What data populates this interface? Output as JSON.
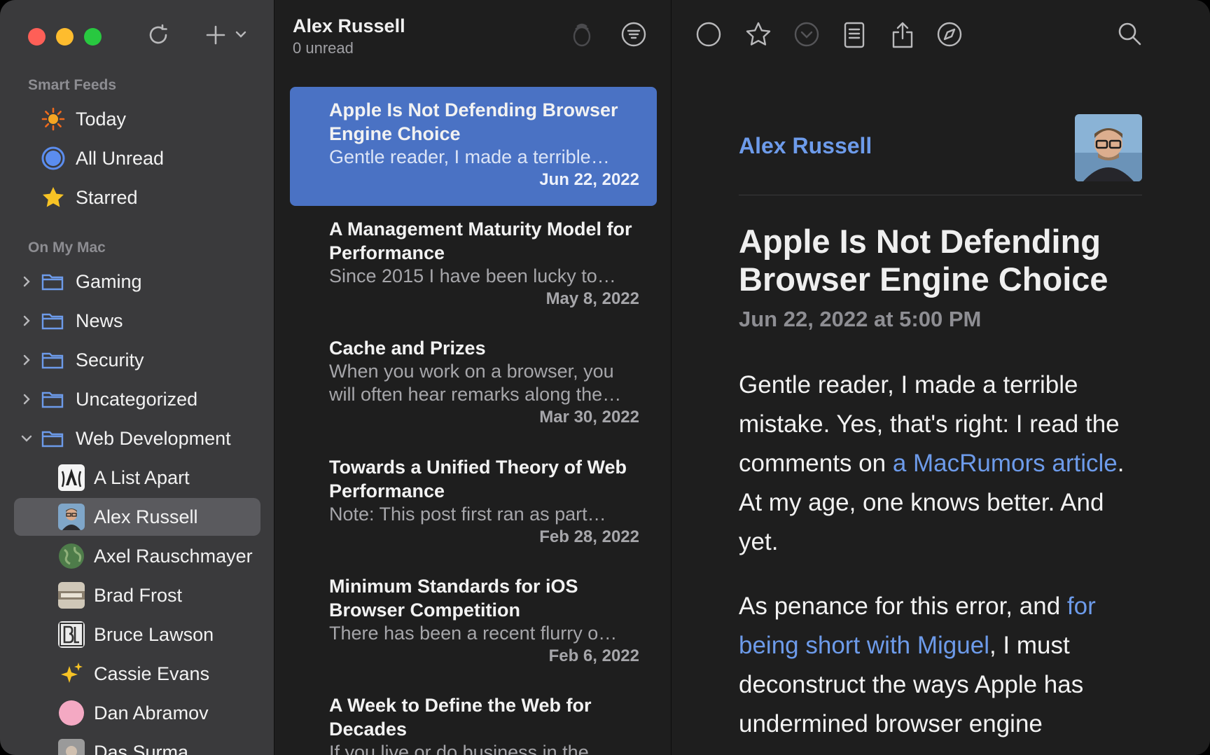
{
  "sidebar": {
    "smart_feeds_header": "Smart Feeds",
    "smart_feeds": [
      {
        "label": "Today",
        "icon": "sun-icon"
      },
      {
        "label": "All Unread",
        "icon": "unread-circle-icon"
      },
      {
        "label": "Starred",
        "icon": "star-icon"
      }
    ],
    "on_my_mac_header": "On My Mac",
    "folders": [
      {
        "label": "Gaming",
        "expanded": false
      },
      {
        "label": "News",
        "expanded": false
      },
      {
        "label": "Security",
        "expanded": false
      },
      {
        "label": "Uncategorized",
        "expanded": false
      },
      {
        "label": "Web Development",
        "expanded": true
      }
    ],
    "feeds": [
      {
        "label": "A List Apart",
        "icon": "a-list-apart-icon"
      },
      {
        "label": "Alex Russell",
        "icon": "alex-russell-avatar",
        "selected": true
      },
      {
        "label": "Axel Rauschmayer",
        "icon": "globe-icon"
      },
      {
        "label": "Brad Frost",
        "icon": "brad-frost-icon"
      },
      {
        "label": "Bruce Lawson",
        "icon": "bruce-lawson-icon"
      },
      {
        "label": "Cassie Evans",
        "icon": "sparkles-icon"
      },
      {
        "label": "Dan Abramov",
        "icon": "pink-circle-icon"
      },
      {
        "label": "Das Surma",
        "icon": "das-surma-avatar"
      }
    ]
  },
  "list": {
    "title": "Alex Russell",
    "subtitle": "0 unread",
    "articles": [
      {
        "title": "Apple Is Not Defending Browser Engine Choice",
        "summary": "Gentle reader, I made a terrible…",
        "date": "Jun 22, 2022",
        "selected": true
      },
      {
        "title": "A Management Maturity Model for Performance",
        "summary": "Since 2015 I have been lucky to…",
        "date": "May 8, 2022"
      },
      {
        "title": "Cache and Prizes",
        "summary": "When you work on a browser, you will often hear remarks along the…",
        "date": "Mar 30, 2022"
      },
      {
        "title": "Towards a Unified Theory of Web Performance",
        "summary": "Note: This post first ran as part…",
        "date": "Feb 28, 2022"
      },
      {
        "title": "Minimum Standards for iOS Browser Competition",
        "summary": "There has been a recent flurry o…",
        "date": "Feb 6, 2022"
      },
      {
        "title": "A Week to Define the Web for Decades",
        "summary": "If you live or do business in the…",
        "date": ""
      }
    ]
  },
  "reader": {
    "author": "Alex Russell",
    "title": "Apple Is Not Defending Browser Engine Choice",
    "date": "Jun 22, 2022 at 5:00 PM",
    "p1_a": "Gentle reader, I made a terrible mistake. Yes, that's right: I read the comments on ",
    "p1_link": "a MacRumors article",
    "p1_b": ". At my age, one knows better. And yet.",
    "p2_a": "As penance for this error, and ",
    "p2_link": "for being short with Miguel",
    "p2_b": ", I must deconstruct the ways Apple has undermined browser engine"
  },
  "colors": {
    "accent": "#4a72c4",
    "link": "#6d9bea",
    "sidebar_bg": "#3a3a3c",
    "content_bg": "#1e1e1e"
  }
}
